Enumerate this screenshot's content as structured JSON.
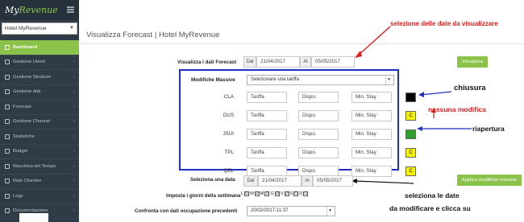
{
  "brand": {
    "prefix": "My",
    "name": "Revenue"
  },
  "hotel_select": {
    "value": "Hotel MyRevenue"
  },
  "menu": [
    {
      "label": "Dashboard",
      "icon": "dashboard-icon",
      "active": true
    },
    {
      "label": "Gestione Utenti",
      "icon": "users-icon",
      "chevron": "‹"
    },
    {
      "label": "Gestione Strutture",
      "icon": "building-icon",
      "chevron": "‹"
    },
    {
      "label": "Gestione dati",
      "icon": "database-icon",
      "chevron": "‹"
    },
    {
      "label": "Forecast",
      "icon": "chart-icon",
      "chevron": "‹"
    },
    {
      "label": "Gestione Channel",
      "icon": "channel-icon",
      "chevron": "‹"
    },
    {
      "label": "Statistiche",
      "icon": "stats-icon",
      "chevron": "‹"
    },
    {
      "label": "Budget",
      "icon": "budget-icon",
      "chevron": "‹"
    },
    {
      "label": "Macchina del Tempo",
      "icon": "clock-icon",
      "chevron": "‹"
    },
    {
      "label": "Rate Checker",
      "icon": "rate-icon",
      "chevron": "‹"
    },
    {
      "label": "Logs",
      "icon": "logs-icon",
      "chevron": "‹"
    },
    {
      "label": "Documentazione",
      "icon": "docs-icon",
      "chevron": "‹"
    }
  ],
  "page": {
    "title": "Visualizza Forecast | Hotel MyRevenue"
  },
  "visualizza": {
    "label": "Visualizza i dati Forecast",
    "dal": "Dal",
    "date_from": "21/04/2017",
    "al": "Al",
    "date_to": "05/05/2017",
    "button": "Visualizza"
  },
  "massive": {
    "label": "Modifiche Massive",
    "select_value": "Selezionare una tariffa",
    "rows": [
      {
        "code": "CLA",
        "tariffa": "Tariffa",
        "dispo": "Dispo.",
        "minstay": "Min. Stay",
        "status": "",
        "color": "#000000"
      },
      {
        "code": "DUS",
        "tariffa": "Tariffa",
        "dispo": "Dispo.",
        "minstay": "Min. Stay",
        "status": "C",
        "color": "#f7f300"
      },
      {
        "code": "JSUI",
        "tariffa": "Tariffa",
        "dispo": "Dispo.",
        "minstay": "Min. Stay",
        "status": "",
        "color": "#2e9e2e"
      },
      {
        "code": "TPL",
        "tariffa": "Tariffa",
        "dispo": "Dispo.",
        "minstay": "Min. Stay",
        "status": "C",
        "color": "#f7f300"
      },
      {
        "code": "QDL",
        "tariffa": "Tariffa",
        "dispo": "Dispo.",
        "minstay": "Min. Stay",
        "status": "C",
        "color": "#f7f300"
      }
    ]
  },
  "seleziona": {
    "label": "Seleziona una data",
    "dal": "Dal",
    "date_from": "21/04/2017",
    "al": "Al",
    "date_to": "05/05/2017",
    "button": "Applica modifiche massive"
  },
  "giorni": {
    "label": "Imposta i giorni della settimana",
    "days": [
      "L",
      "M",
      "M",
      "G",
      "V",
      "S",
      "D"
    ],
    "check": "☑"
  },
  "confronta": {
    "label": "Confronta con dati occupazione precedenti",
    "select_value": "20/02/2017-11:37"
  },
  "annotations": {
    "top": "selezione delle date da visualizzare",
    "chiusura": "chiusura",
    "nessuna": "nessuna modifica",
    "riapertura": "riapertura",
    "bottom1": "seleziona le date",
    "bottom2": "da modificare e clicca su"
  }
}
